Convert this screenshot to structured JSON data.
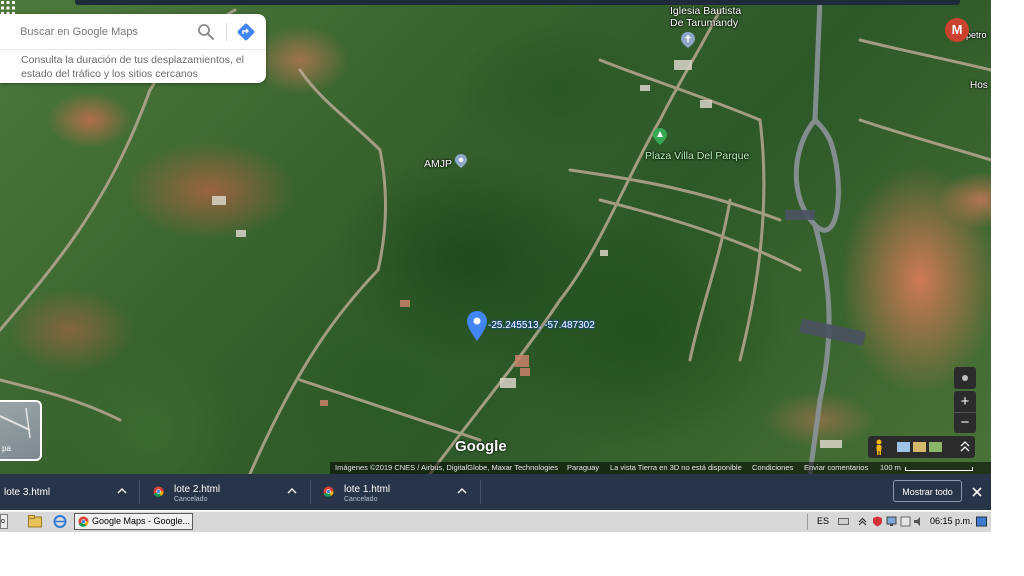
{
  "search": {
    "placeholder": "Buscar en Google Maps",
    "hint": "Consulta la duración de tus desplazamientos, el estado del tráfico y los sitios cercanos"
  },
  "account": {
    "initial": "M"
  },
  "map_labels": {
    "church": "Iglesia Bautista De Tarumandy",
    "church_line1": "Iglesia Bautista",
    "church_line2": "De Tarumandy",
    "plaza": "Plaza Villa Del Parque",
    "amjp": "AMJP",
    "petro": "petro",
    "hos": "Hos",
    "coordinates": "-25.245513, -57.487302"
  },
  "layer_thumb": {
    "label": "pa"
  },
  "zoom": {
    "in": "+",
    "out": "−"
  },
  "google_logo": "Google",
  "attribution": {
    "imagery": "Imágenes ©2019 CNES / Airbus, DigitalGlobe, Maxar Technologies",
    "country": "Paraguay",
    "earth_3d": "La vista Tierra en 3D no está disponible",
    "terms": "Condiciones",
    "feedback": "Enviar comentarios",
    "scale": "100 m"
  },
  "downloads": {
    "items": [
      {
        "name": "lote 3.html",
        "status": ""
      },
      {
        "name": "lote 2.html",
        "status": "Cancelado"
      },
      {
        "name": "lote 1.html",
        "status": "Cancelado"
      }
    ],
    "show_all": "Mostrar todo"
  },
  "taskbar": {
    "start_stub": "o",
    "window_title": "Google Maps - Google...",
    "language": "ES",
    "clock": "06:15 p.m."
  },
  "colors": {
    "downloads_bg": "#283447",
    "marker_blue": "#4285f4",
    "avatar": "#c9422e",
    "plaza_pin": "#34a853"
  }
}
